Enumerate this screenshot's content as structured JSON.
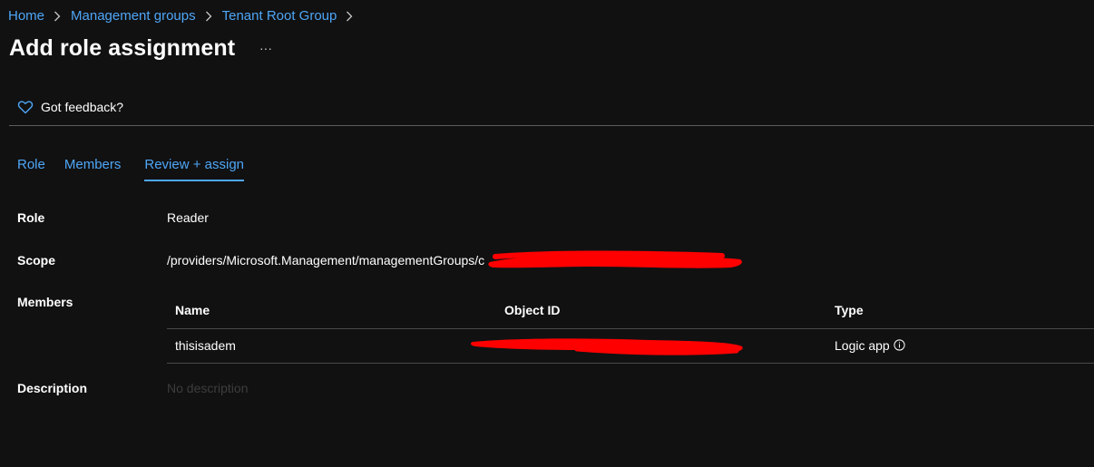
{
  "breadcrumb": {
    "items": [
      "Home",
      "Management groups",
      "Tenant Root Group"
    ]
  },
  "page": {
    "title": "Add role assignment",
    "more_label": "···"
  },
  "toolbar": {
    "feedback_label": "Got feedback?"
  },
  "tabs": [
    {
      "label": "Role",
      "active": false
    },
    {
      "label": "Members",
      "active": false
    },
    {
      "label": "Review + assign",
      "active": true
    }
  ],
  "details": {
    "role_label": "Role",
    "role_value": "Reader",
    "scope_label": "Scope",
    "scope_value": "/providers/Microsoft.Management/managementGroups/c",
    "members_label": "Members",
    "description_label": "Description",
    "description_value": "No description"
  },
  "members_table": {
    "headers": {
      "name": "Name",
      "object_id": "Object ID",
      "type": "Type"
    },
    "rows": [
      {
        "name": "thisisadem",
        "object_id": "",
        "type": "Logic app"
      }
    ]
  },
  "colors": {
    "background": "#111112",
    "link": "#4ea6f6",
    "redaction": "#ff0000"
  }
}
